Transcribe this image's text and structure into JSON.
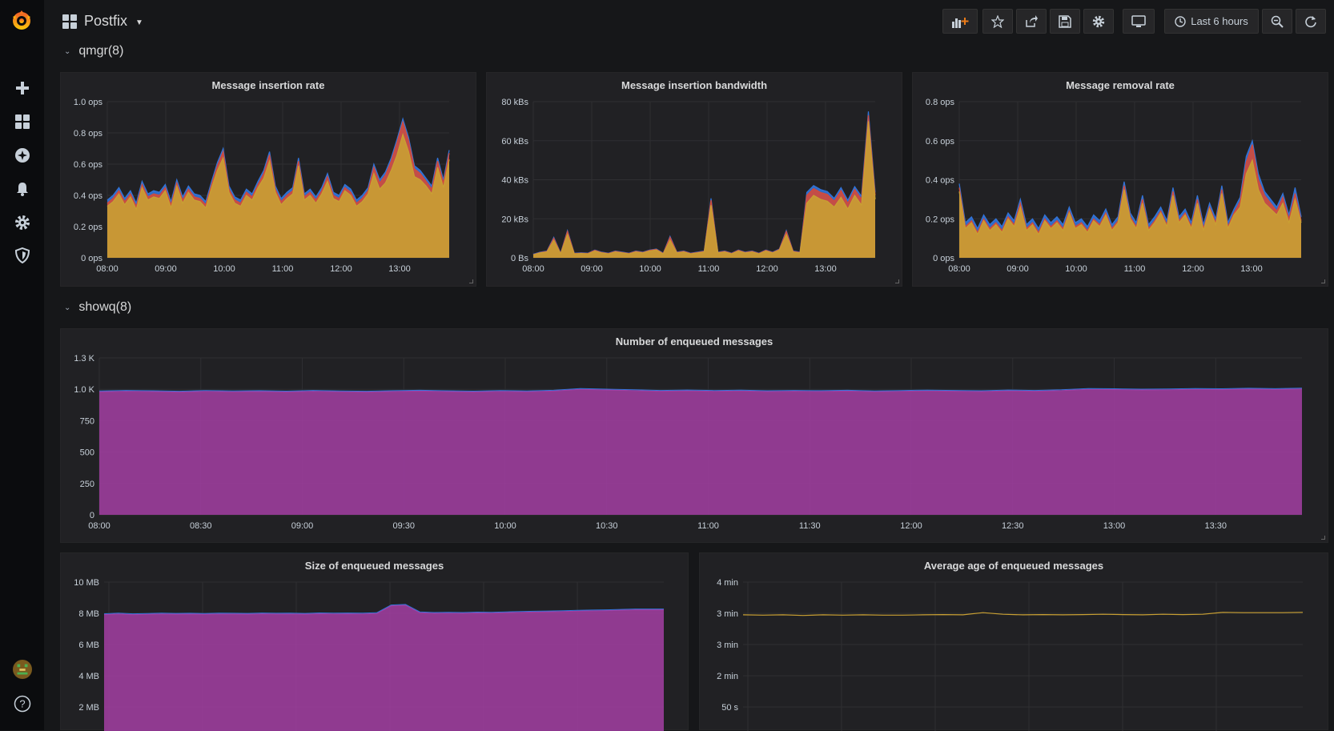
{
  "dashboard": {
    "title": "Postfix"
  },
  "toolbar": {
    "time_range": "Last 6 hours"
  },
  "rows": [
    {
      "title": "qmgr(8)"
    },
    {
      "title": "showq(8)"
    }
  ],
  "colors": {
    "yellow": "#c9a033",
    "red": "#d44a3a",
    "blue": "#3274d9",
    "green": "#56a64b",
    "purple": "#a33ea3",
    "grid": "#2f2f32",
    "background": "#212124"
  },
  "chart_data": [
    {
      "type": "area",
      "title": "Message insertion rate",
      "y_ticks": [
        "1.0 ops",
        "0.8 ops",
        "0.6 ops",
        "0.4 ops",
        "0.2 ops",
        "0 ops"
      ],
      "x_ticks": [
        "08:00",
        "09:00",
        "10:00",
        "11:00",
        "12:00",
        "13:00"
      ],
      "ylim": [
        0,
        1.0
      ],
      "series": [
        {
          "color": "#c9a033",
          "values": [
            0.33,
            0.36,
            0.41,
            0.34,
            0.39,
            0.31,
            0.45,
            0.37,
            0.39,
            0.38,
            0.43,
            0.32,
            0.46,
            0.35,
            0.42,
            0.37,
            0.36,
            0.32,
            0.45,
            0.56,
            0.64,
            0.42,
            0.35,
            0.33,
            0.4,
            0.37,
            0.45,
            0.51,
            0.62,
            0.42,
            0.34,
            0.38,
            0.41,
            0.59,
            0.37,
            0.4,
            0.35,
            0.41,
            0.49,
            0.38,
            0.36,
            0.43,
            0.4,
            0.33,
            0.36,
            0.41,
            0.54,
            0.44,
            0.48,
            0.56,
            0.66,
            0.79,
            0.68,
            0.52,
            0.5,
            0.46,
            0.41,
            0.58,
            0.45,
            0.63
          ]
        },
        {
          "color": "#d44a3a",
          "values": [
            0.35,
            0.38,
            0.43,
            0.36,
            0.41,
            0.33,
            0.47,
            0.39,
            0.41,
            0.4,
            0.45,
            0.34,
            0.48,
            0.37,
            0.44,
            0.39,
            0.38,
            0.34,
            0.47,
            0.59,
            0.68,
            0.44,
            0.37,
            0.35,
            0.42,
            0.39,
            0.47,
            0.54,
            0.66,
            0.44,
            0.36,
            0.4,
            0.43,
            0.62,
            0.39,
            0.42,
            0.37,
            0.43,
            0.52,
            0.4,
            0.38,
            0.45,
            0.42,
            0.35,
            0.38,
            0.43,
            0.58,
            0.48,
            0.53,
            0.62,
            0.74,
            0.87,
            0.75,
            0.57,
            0.54,
            0.49,
            0.44,
            0.62,
            0.48,
            0.67
          ]
        },
        {
          "color": "#3274d9",
          "values": [
            0.37,
            0.4,
            0.45,
            0.38,
            0.43,
            0.35,
            0.49,
            0.41,
            0.43,
            0.42,
            0.47,
            0.36,
            0.5,
            0.39,
            0.46,
            0.41,
            0.4,
            0.36,
            0.49,
            0.61,
            0.7,
            0.46,
            0.39,
            0.37,
            0.44,
            0.41,
            0.49,
            0.56,
            0.68,
            0.46,
            0.38,
            0.42,
            0.45,
            0.64,
            0.41,
            0.44,
            0.39,
            0.45,
            0.54,
            0.42,
            0.4,
            0.47,
            0.44,
            0.37,
            0.4,
            0.45,
            0.6,
            0.5,
            0.55,
            0.64,
            0.76,
            0.89,
            0.77,
            0.59,
            0.56,
            0.51,
            0.46,
            0.64,
            0.5,
            0.69
          ]
        }
      ]
    },
    {
      "type": "area",
      "title": "Message insertion bandwidth",
      "y_ticks": [
        "80 kBs",
        "60 kBs",
        "40 kBs",
        "20 kBs",
        "0 Bs"
      ],
      "x_ticks": [
        "08:00",
        "09:00",
        "10:00",
        "11:00",
        "12:00",
        "13:00"
      ],
      "ylim": [
        0,
        80000
      ],
      "series": [
        {
          "color": "#c9a033",
          "values": [
            1500,
            2500,
            3000,
            9000,
            2000,
            12000,
            2000,
            2200,
            2000,
            3500,
            2500,
            2000,
            3000,
            2500,
            2000,
            3000,
            2500,
            3500,
            4000,
            2000,
            9000,
            2500,
            3000,
            2000,
            2500,
            3000,
            27000,
            2500,
            3000,
            2000,
            3500,
            2500,
            3000,
            2000,
            3500,
            2500,
            4000,
            12000,
            3000,
            2500,
            28000,
            32000,
            30000,
            29000,
            26000,
            31000,
            25000,
            32000,
            27000,
            70000,
            30000
          ]
        },
        {
          "color": "#d44a3a",
          "values": [
            1700,
            2700,
            3300,
            10000,
            2200,
            13500,
            2200,
            2400,
            2200,
            3800,
            2700,
            2200,
            3300,
            2700,
            2200,
            3300,
            2700,
            3800,
            4300,
            2200,
            10500,
            2700,
            3300,
            2200,
            2700,
            3300,
            29500,
            2700,
            3300,
            2200,
            3800,
            2700,
            3300,
            2200,
            3800,
            2700,
            4300,
            13500,
            3300,
            2700,
            32000,
            35500,
            33500,
            32500,
            29000,
            34500,
            28000,
            35000,
            30000,
            73000,
            32000
          ]
        },
        {
          "color": "#3274d9",
          "values": [
            1900,
            2900,
            3500,
            10500,
            2400,
            14000,
            2400,
            2600,
            2400,
            4000,
            2900,
            2400,
            3500,
            2900,
            2400,
            3500,
            2900,
            4000,
            4500,
            2400,
            11000,
            2900,
            3500,
            2400,
            2900,
            3500,
            30500,
            2900,
            3500,
            2400,
            4000,
            2900,
            3500,
            2400,
            4000,
            2900,
            4500,
            14000,
            3500,
            2900,
            33500,
            37000,
            35000,
            34000,
            30500,
            36000,
            29500,
            36500,
            31500,
            75000,
            33500
          ]
        }
      ]
    },
    {
      "type": "area",
      "title": "Message removal rate",
      "y_ticks": [
        "0.8 ops",
        "0.6 ops",
        "0.4 ops",
        "0.2 ops",
        "0 ops"
      ],
      "x_ticks": [
        "08:00",
        "09:00",
        "10:00",
        "11:00",
        "12:00",
        "13:00"
      ],
      "ylim": [
        0,
        0.8
      ],
      "series": [
        {
          "color": "#c9a033",
          "values": [
            0.34,
            0.15,
            0.18,
            0.12,
            0.19,
            0.14,
            0.17,
            0.13,
            0.2,
            0.16,
            0.26,
            0.14,
            0.17,
            0.12,
            0.19,
            0.15,
            0.18,
            0.14,
            0.23,
            0.15,
            0.17,
            0.13,
            0.19,
            0.16,
            0.22,
            0.14,
            0.18,
            0.35,
            0.2,
            0.15,
            0.28,
            0.14,
            0.18,
            0.23,
            0.16,
            0.32,
            0.18,
            0.22,
            0.15,
            0.28,
            0.14,
            0.25,
            0.17,
            0.33,
            0.15,
            0.22,
            0.26,
            0.43,
            0.5,
            0.35,
            0.28,
            0.25,
            0.22,
            0.28,
            0.18,
            0.3,
            0.18
          ]
        },
        {
          "color": "#d44a3a",
          "values": [
            0.36,
            0.16,
            0.19,
            0.13,
            0.2,
            0.15,
            0.18,
            0.14,
            0.21,
            0.17,
            0.28,
            0.15,
            0.18,
            0.13,
            0.2,
            0.16,
            0.19,
            0.15,
            0.24,
            0.16,
            0.18,
            0.14,
            0.2,
            0.17,
            0.23,
            0.15,
            0.19,
            0.37,
            0.21,
            0.16,
            0.3,
            0.15,
            0.19,
            0.24,
            0.17,
            0.34,
            0.19,
            0.23,
            0.16,
            0.3,
            0.15,
            0.26,
            0.18,
            0.35,
            0.16,
            0.23,
            0.29,
            0.49,
            0.58,
            0.4,
            0.32,
            0.28,
            0.24,
            0.31,
            0.2,
            0.33,
            0.19
          ]
        },
        {
          "color": "#3274d9",
          "values": [
            0.38,
            0.18,
            0.21,
            0.15,
            0.22,
            0.17,
            0.2,
            0.16,
            0.23,
            0.19,
            0.3,
            0.17,
            0.2,
            0.15,
            0.22,
            0.18,
            0.21,
            0.17,
            0.26,
            0.18,
            0.2,
            0.16,
            0.22,
            0.19,
            0.25,
            0.17,
            0.21,
            0.39,
            0.23,
            0.18,
            0.32,
            0.17,
            0.21,
            0.26,
            0.19,
            0.36,
            0.21,
            0.25,
            0.18,
            0.32,
            0.17,
            0.28,
            0.2,
            0.37,
            0.18,
            0.25,
            0.31,
            0.52,
            0.6,
            0.43,
            0.34,
            0.3,
            0.26,
            0.33,
            0.22,
            0.36,
            0.21
          ]
        }
      ]
    },
    {
      "type": "area",
      "title": "Number of enqueued messages",
      "y_ticks": [
        "1.3 K",
        "1.0 K",
        "750",
        "500",
        "250",
        "0"
      ],
      "x_ticks": [
        "08:00",
        "08:30",
        "09:00",
        "09:30",
        "10:00",
        "10:30",
        "11:00",
        "11:30",
        "12:00",
        "12:30",
        "13:00",
        "13:30"
      ],
      "ylim": [
        0,
        1250
      ],
      "series": [
        {
          "color": "#a33ea3",
          "values": [
            980,
            985,
            982,
            978,
            984,
            980,
            983,
            979,
            985,
            981,
            978,
            983,
            986,
            982,
            979,
            984,
            981,
            986,
            1000,
            995,
            990,
            985,
            988,
            984,
            987,
            982,
            985,
            983,
            986,
            981,
            984,
            987,
            985,
            982,
            988,
            985,
            990,
            1000,
            998,
            995,
            996,
            1000,
            998,
            1002,
            999,
            1003
          ]
        }
      ]
    },
    {
      "type": "area",
      "title": "Size of enqueued messages",
      "y_ticks": [
        "10 MB",
        "8 MB",
        "6 MB",
        "4 MB",
        "2 MB"
      ],
      "x_ticks": [],
      "ylim": [
        0,
        10
      ],
      "series": [
        {
          "color": "#a33ea3",
          "values": [
            7.4,
            7.45,
            7.4,
            7.42,
            7.45,
            7.43,
            7.44,
            7.42,
            7.45,
            7.44,
            7.43,
            7.46,
            7.44,
            7.45,
            7.43,
            7.47,
            7.45,
            7.46,
            7.45,
            7.48,
            8.1,
            8.15,
            7.55,
            7.5,
            7.52,
            7.5,
            7.53,
            7.52,
            7.55,
            7.58,
            7.6,
            7.62,
            7.65,
            7.68,
            7.7,
            7.72,
            7.75,
            7.78,
            7.78,
            7.78
          ]
        }
      ]
    },
    {
      "type": "line",
      "title": "Average age of enqueued messages",
      "y_ticks": [
        "4 min",
        "3 min",
        "3 min",
        "2 min",
        "50 s"
      ],
      "x_ticks": [],
      "ylim": [
        0,
        4
      ],
      "series": [
        {
          "color": "#c9a033",
          "values": [
            2.95,
            2.94,
            2.95,
            2.93,
            2.95,
            2.94,
            2.95,
            2.94,
            2.94,
            2.95,
            2.96,
            2.95,
            3.02,
            2.97,
            2.95,
            2.96,
            2.95,
            2.96,
            2.97,
            2.96,
            2.95,
            2.97,
            2.96,
            2.97,
            3.03,
            3.02,
            3.02,
            3.02,
            3.03
          ]
        }
      ]
    }
  ]
}
